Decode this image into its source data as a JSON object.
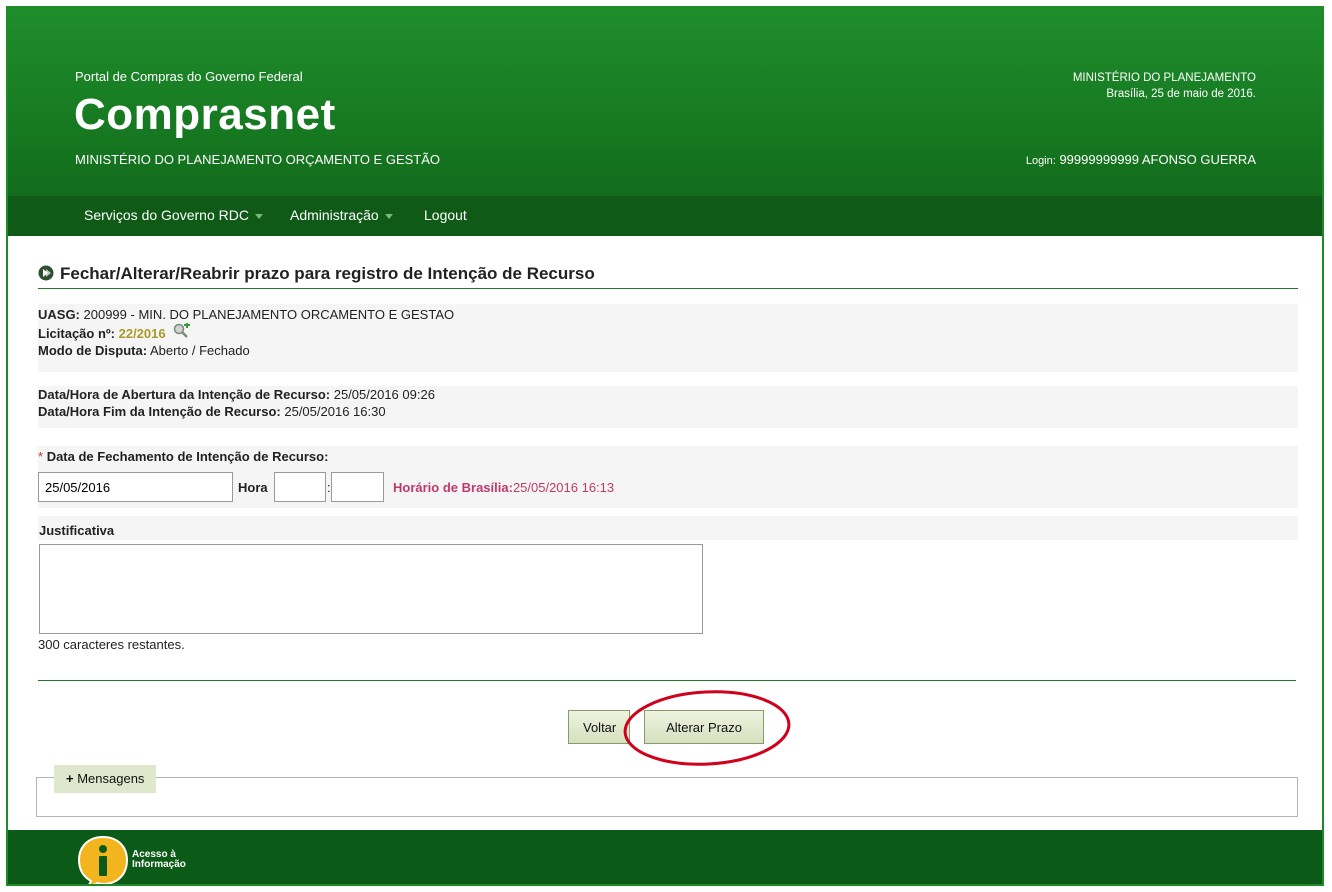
{
  "header": {
    "portal": "Portal de Compras do Governo Federal",
    "brand": "Comprasnet",
    "ministry": "MINISTÉRIO DO PLANEJAMENTO ORÇAMENTO E GESTÃO",
    "org": "MINISTÉRIO DO PLANEJAMENTO",
    "date": "Brasília, 25 de maio de 2016.",
    "login_label": "Login:",
    "login_value": "99999999999 AFONSO GUERRA"
  },
  "nav": {
    "item1": "Serviços do Governo RDC",
    "item2": "Administração",
    "item3": "Logout"
  },
  "page": {
    "title": "Fechar/Alterar/Reabrir prazo para registro de Intenção de Recurso"
  },
  "info": {
    "uasg_label": "UASG:",
    "uasg_value": "200999 - MIN. DO PLANEJAMENTO ORCAMENTO E GESTAO",
    "licitacao_label": "Licitação nº:",
    "licitacao_value": "22/2016",
    "modo_label": "Modo de Disputa:",
    "modo_value": "Aberto / Fechado",
    "abertura_label": "Data/Hora de Abertura da Intenção de Recurso:",
    "abertura_value": "25/05/2016 09:26",
    "fim_label": "Data/Hora Fim da Intenção de Recurso:",
    "fim_value": "25/05/2016 16:30"
  },
  "form": {
    "required_mark": "*",
    "fechamento_label": "Data de Fechamento de Intenção de Recurso:",
    "date_value": "25/05/2016",
    "hora_label": "Hora",
    "hora_sep": ":",
    "brasilia_label": "Horário de Brasília:",
    "brasilia_value": "25/05/2016 16:13",
    "justificativa_label": "Justificativa",
    "justificativa_value": "",
    "counter": "300 caracteres restantes."
  },
  "buttons": {
    "voltar": "Voltar",
    "alterar": "Alterar Prazo"
  },
  "messages": {
    "toggle_icon": "+",
    "label": "Mensagens"
  },
  "footer": {
    "acesso_line1": "Acesso à",
    "acesso_line2": "Informação"
  },
  "colors": {
    "header_green": "#1f8d2b",
    "nav_green": "#0f5a17",
    "highlight_red": "#d0021b"
  }
}
